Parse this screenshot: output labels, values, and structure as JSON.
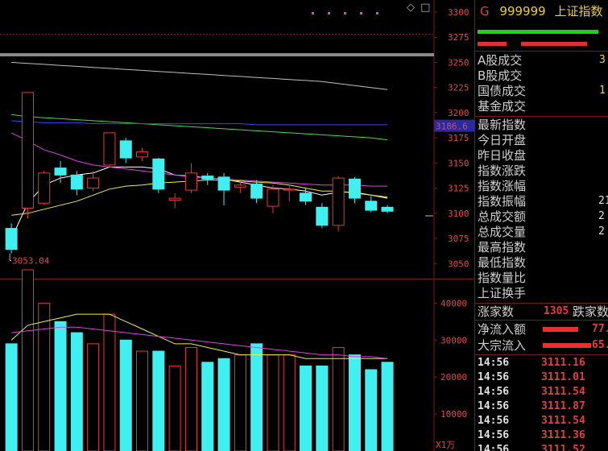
{
  "header": {
    "g_mark": "G",
    "code": "999999",
    "name": "上证指数"
  },
  "top_icons": {
    "diamond": "◇",
    "box": "□"
  },
  "colors": {
    "up": "#e03c3c",
    "down": "#40f0f0",
    "ma5": "#ffffff",
    "ma10": "#f0f040",
    "ma20": "#e040e0",
    "ma60": "#40e040",
    "ma120": "#4040ff",
    "ma250": "#c0c0c0",
    "grid": "#7a1a1a"
  },
  "price_axis": {
    "ticks": [
      "3300",
      "3275",
      "3250",
      "3225",
      "3200",
      "3175",
      "3150",
      "3125",
      "3100",
      "3075",
      "3050"
    ],
    "current_tag": "3186.6",
    "low_label": "3053.04"
  },
  "volume_axis": {
    "ticks": [
      "40000",
      "30000",
      "20000",
      "10000"
    ],
    "unit": "X1万"
  },
  "info_rows_a": [
    {
      "label": "A股成交",
      "value": "3"
    },
    {
      "label": "B股成交",
      "value": ""
    },
    {
      "label": "国债成交",
      "value": "1"
    },
    {
      "label": "基金成交",
      "value": ""
    }
  ],
  "info_rows_b": [
    {
      "label": "最新指数",
      "value": ""
    },
    {
      "label": "今日开盘",
      "value": ""
    },
    {
      "label": "昨日收盘",
      "value": ""
    },
    {
      "label": "指数涨跌",
      "value": ""
    },
    {
      "label": "指数涨幅",
      "value": ""
    },
    {
      "label": "指数振幅",
      "value": "21"
    },
    {
      "label": "总成交额",
      "value": "2"
    },
    {
      "label": "总成交量",
      "value": "2"
    },
    {
      "label": "最高指数",
      "value": ""
    },
    {
      "label": "最低指数",
      "value": ""
    },
    {
      "label": "指数量比",
      "value": ""
    },
    {
      "label": "上证换手",
      "value": ""
    }
  ],
  "breadth": {
    "up_label": "涨家数",
    "up_count": "1305",
    "down_label": "跌家数"
  },
  "flows": [
    {
      "label": "净流入额",
      "value": "77."
    },
    {
      "label": "大宗流入",
      "value": "65."
    }
  ],
  "ticks": [
    {
      "time": "14:56",
      "price": "3111.16"
    },
    {
      "time": "14:56",
      "price": "3111.01"
    },
    {
      "time": "14:56",
      "price": "3111.54"
    },
    {
      "time": "14:56",
      "price": "3111.87"
    },
    {
      "time": "14:56",
      "price": "3111.54"
    },
    {
      "time": "14:56",
      "price": "3111.36"
    },
    {
      "time": "14:56",
      "price": "3111.52"
    }
  ],
  "chart_data": {
    "type": "candlestick",
    "y_range": [
      3035,
      3312
    ],
    "volume_range": [
      0,
      44000
    ],
    "candles": [
      {
        "open": 3085,
        "close": 3064,
        "high": 3090,
        "low": 3060,
        "volume": 29000
      },
      {
        "open": 3105,
        "close": 3220,
        "high": 3220,
        "low": 3095,
        "volume": 49000
      },
      {
        "open": 3110,
        "close": 3140,
        "high": 3142,
        "low": 3108,
        "volume": 40000
      },
      {
        "open": 3145,
        "close": 3138,
        "high": 3152,
        "low": 3130,
        "volume": 35000
      },
      {
        "open": 3138,
        "close": 3124,
        "high": 3142,
        "low": 3118,
        "volume": 32000
      },
      {
        "open": 3125,
        "close": 3135,
        "high": 3142,
        "low": 3122,
        "volume": 29000
      },
      {
        "open": 3148,
        "close": 3180,
        "high": 3180,
        "low": 3146,
        "volume": 37000
      },
      {
        "open": 3172,
        "close": 3155,
        "high": 3175,
        "low": 3150,
        "volume": 30000
      },
      {
        "open": 3156,
        "close": 3161,
        "high": 3165,
        "low": 3152,
        "volume": 27000
      },
      {
        "open": 3154,
        "close": 3124,
        "high": 3155,
        "low": 3120,
        "volume": 27000
      },
      {
        "open": 3113,
        "close": 3115,
        "high": 3120,
        "low": 3105,
        "volume": 23000
      },
      {
        "open": 3123,
        "close": 3140,
        "high": 3150,
        "low": 3120,
        "volume": 28000
      },
      {
        "open": 3137,
        "close": 3134,
        "high": 3140,
        "low": 3128,
        "volume": 24000
      },
      {
        "open": 3136,
        "close": 3123,
        "high": 3140,
        "low": 3108,
        "volume": 25000
      },
      {
        "open": 3126,
        "close": 3128,
        "high": 3132,
        "low": 3120,
        "volume": 26000
      },
      {
        "open": 3129,
        "close": 3115,
        "high": 3133,
        "low": 3110,
        "volume": 29000
      },
      {
        "open": 3107,
        "close": 3124,
        "high": 3128,
        "low": 3100,
        "volume": 26000
      },
      {
        "open": 3123,
        "close": 3124,
        "high": 3128,
        "low": 3112,
        "volume": 26000
      },
      {
        "open": 3120,
        "close": 3112,
        "high": 3125,
        "low": 3108,
        "volume": 23000
      },
      {
        "open": 3106,
        "close": 3088,
        "high": 3110,
        "low": 3085,
        "volume": 23000
      },
      {
        "open": 3088,
        "close": 3135,
        "high": 3137,
        "low": 3082,
        "volume": 28000
      },
      {
        "open": 3134,
        "close": 3115,
        "high": 3136,
        "low": 3110,
        "volume": 26000
      },
      {
        "open": 3112,
        "close": 3103,
        "high": 3117,
        "low": 3101,
        "volume": 22000
      },
      {
        "open": 3106,
        "close": 3102,
        "high": 3108,
        "low": 3100,
        "volume": 24000
      }
    ],
    "ma_lines": [
      {
        "name": "MA5",
        "values": [
          3075,
          3110,
          3128,
          3135,
          3138,
          3140,
          3146,
          3146,
          3146,
          3144,
          3138,
          3137,
          3135,
          3134,
          3131,
          3128,
          3125,
          3124,
          3122,
          3118,
          3121,
          3121,
          3118,
          3115
        ]
      },
      {
        "name": "MA10",
        "values": [
          3098,
          3100,
          3104,
          3108,
          3112,
          3118,
          3124,
          3127,
          3128,
          3130,
          3131,
          3132,
          3133,
          3133,
          3132,
          3131,
          3130,
          3128,
          3125,
          3122,
          3122,
          3120,
          3118,
          3116
        ]
      },
      {
        "name": "MA20",
        "values": [
          3180,
          3172,
          3163,
          3158,
          3152,
          3148,
          3146,
          3144,
          3142,
          3140,
          3138,
          3136,
          3135,
          3134,
          3133,
          3132,
          3131,
          3130,
          3129,
          3128,
          3128,
          3128,
          3127,
          3127
        ]
      },
      {
        "name": "MA60",
        "values": [
          3198,
          3196,
          3195,
          3194,
          3193,
          3192,
          3191,
          3190,
          3189,
          3188,
          3187,
          3186,
          3185,
          3184,
          3183,
          3182,
          3181,
          3180,
          3179,
          3178,
          3177,
          3176,
          3175,
          3173
        ]
      },
      {
        "name": "MA120",
        "values": [
          3192,
          3191,
          3190,
          3190,
          3190,
          3189,
          3189,
          3189,
          3189,
          3189,
          3189,
          3189,
          3189,
          3189,
          3189,
          3188,
          3188,
          3188,
          3188,
          3188,
          3188,
          3188,
          3188,
          3188
        ]
      },
      {
        "name": "MA250",
        "values": [
          3250,
          3249,
          3248,
          3247,
          3246,
          3245,
          3244,
          3243,
          3242,
          3241,
          3240,
          3239,
          3238,
          3237,
          3236,
          3235,
          3234,
          3233,
          3232,
          3231,
          3229,
          3227,
          3225,
          3223
        ]
      }
    ],
    "vol_ma_lines": [
      {
        "name": "VMA5",
        "values": [
          30000,
          34000,
          35000,
          36000,
          37000,
          37000,
          37000,
          35000,
          33000,
          31000,
          29000,
          29000,
          28000,
          27000,
          26000,
          26000,
          26000,
          26000,
          25000,
          25000,
          25000,
          25000,
          25000,
          25000
        ]
      },
      {
        "name": "VMA10",
        "values": [
          32000,
          32500,
          33000,
          33500,
          33500,
          33000,
          32500,
          32000,
          31500,
          31000,
          30500,
          30000,
          29500,
          29000,
          28500,
          28000,
          27500,
          27000,
          26500,
          26000,
          26000,
          25500,
          25500,
          25000
        ]
      }
    ]
  }
}
